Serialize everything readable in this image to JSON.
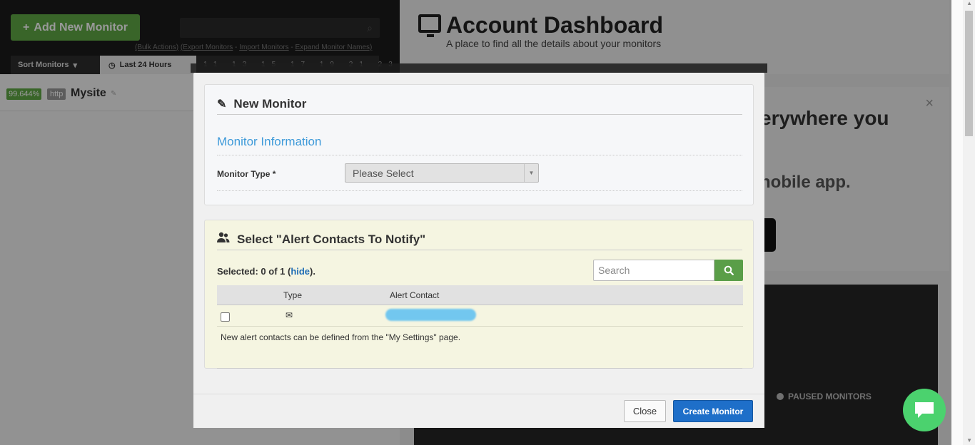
{
  "sidebar": {
    "add_monitor_label": "Add New Monitor",
    "bulk_actions": "(Bulk Actions)",
    "export_monitors": "(Export Monitors",
    "import_monitors": "Import Monitors",
    "expand_names": "Expand Monitor Names)",
    "sort_label": "Sort Monitors",
    "range_label": "Last 24 Hours",
    "hours": "11 13 15 17 19 21 23 1 3 5 7 9",
    "monitor": {
      "uptime": "99.644%",
      "type": "http",
      "name": "Mysite"
    }
  },
  "header": {
    "title": "Account Dashboard",
    "subtitle": "A place to find all the details about your monitors"
  },
  "promo": {
    "heading": "erywhere you",
    "mobile": "nobile app."
  },
  "dashboard": {
    "paused_label": "PAUSED MONITORS"
  },
  "modal": {
    "title": "New Monitor",
    "section_heading": "Monitor Information",
    "monitor_type_label": "Monitor Type *",
    "monitor_type_value": "Please Select",
    "alerts_title": "Select \"Alert Contacts To Notify\"",
    "selected_prefix": "Selected: 0 of 1 (",
    "selected_link": "hide",
    "selected_suffix": ").",
    "search_placeholder": "Search",
    "columns": {
      "type": "Type",
      "contact": "Alert Contact"
    },
    "note": "New alert contacts can be defined from the \"My Settings\" page.",
    "close_label": "Close",
    "create_label": "Create Monitor"
  },
  "colors": {
    "accent_green": "#5fa845",
    "primary_blue": "#1e6fc9",
    "link_blue": "#3e9ad9",
    "chat_green": "#4bd26e"
  }
}
